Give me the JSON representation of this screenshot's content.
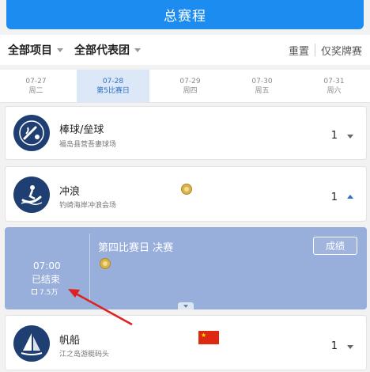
{
  "header": {
    "title": "总赛程"
  },
  "filters": {
    "all_events": "全部项目",
    "all_delegations": "全部代表团",
    "reset": "重置",
    "medal_only": "仅奖牌赛"
  },
  "dates": [
    {
      "date": "07-27",
      "label": "周二"
    },
    {
      "date": "07-28",
      "label": "第5比赛日"
    },
    {
      "date": "07-29",
      "label": "周四"
    },
    {
      "date": "07-30",
      "label": "周五"
    },
    {
      "date": "07-31",
      "label": "周六"
    }
  ],
  "sports": [
    {
      "name": "棒球/垒球",
      "venue": "福岛县营吾妻球场",
      "count": "1",
      "expanded": false
    },
    {
      "name": "冲浪",
      "venue": "钓崎海岸冲浪会场",
      "count": "1",
      "expanded": true
    },
    {
      "name": "帆船",
      "venue": "江之岛游艇码头",
      "count": "1",
      "expanded": false
    }
  ],
  "event": {
    "time": "07:00",
    "status": "已结束",
    "views": "7.5万",
    "round": "第四比赛日 决赛",
    "results_button": "成绩"
  },
  "colors": {
    "accent": "#1d8cf0",
    "pictogram": "#1f3f73",
    "expanded_bg": "#98aedb",
    "arrow": "#e02020"
  },
  "icons": [
    "baseball-pictogram-icon",
    "surfing-pictogram-icon",
    "sailing-pictogram-icon",
    "gold-medal-icon",
    "china-flag-icon",
    "eye-icon",
    "chevron-down-icon",
    "chevron-up-icon"
  ]
}
